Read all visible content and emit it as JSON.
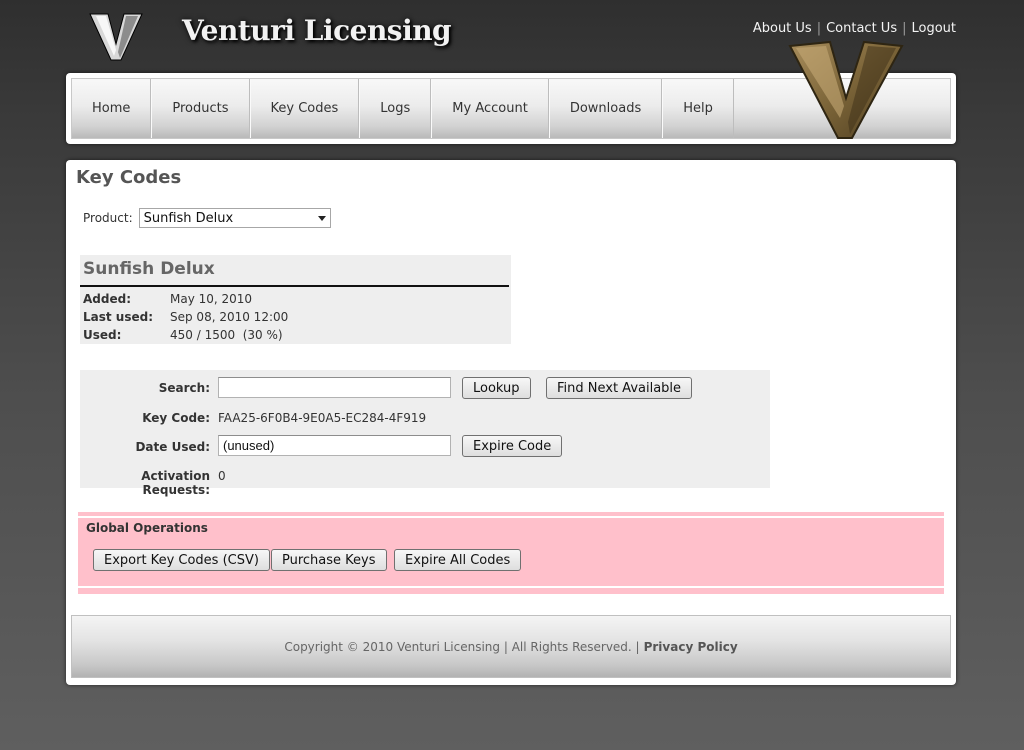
{
  "header": {
    "brand": "Venturi Licensing",
    "top_links": [
      "About Us",
      "Contact Us",
      "Logout"
    ]
  },
  "nav": {
    "items": [
      "Home",
      "Products",
      "Key Codes",
      "Logs",
      "My Account",
      "Downloads",
      "Help"
    ]
  },
  "page": {
    "title": "Key Codes",
    "product_label": "Product:",
    "product_selected": "Sunfish Delux"
  },
  "product_info": {
    "name": "Sunfish Delux",
    "added_label": "Added:",
    "added_value": "May 10, 2010",
    "last_used_label": "Last used:",
    "last_used_value": "Sep 08, 2010 12:00",
    "used_label": "Used:",
    "used_value": "450 / 1500  (30 %)"
  },
  "lookup": {
    "search_label": "Search:",
    "search_value": "",
    "lookup_button": "Lookup",
    "find_next_button": "Find Next Available",
    "key_code_label": "Key Code:",
    "key_code_value": "FAA25-6F0B4-9E0A5-EC284-4F919",
    "date_used_label": "Date Used:",
    "date_used_value": "(unused)",
    "expire_code_button": "Expire Code",
    "activation_label": "Activation Requests:",
    "activation_value": "0"
  },
  "global_ops": {
    "title": "Global Operations",
    "export_button": "Export Key Codes (CSV)",
    "purchase_button": "Purchase Keys",
    "expire_all_button": "Expire All Codes"
  },
  "footer": {
    "copyright": "Copyright © 2010 Venturi Licensing | All Rights Reserved. |",
    "privacy": "Privacy Policy"
  },
  "colors": {
    "global_bg": "#ffc0cb",
    "panel_bg": "#eeeeee"
  }
}
